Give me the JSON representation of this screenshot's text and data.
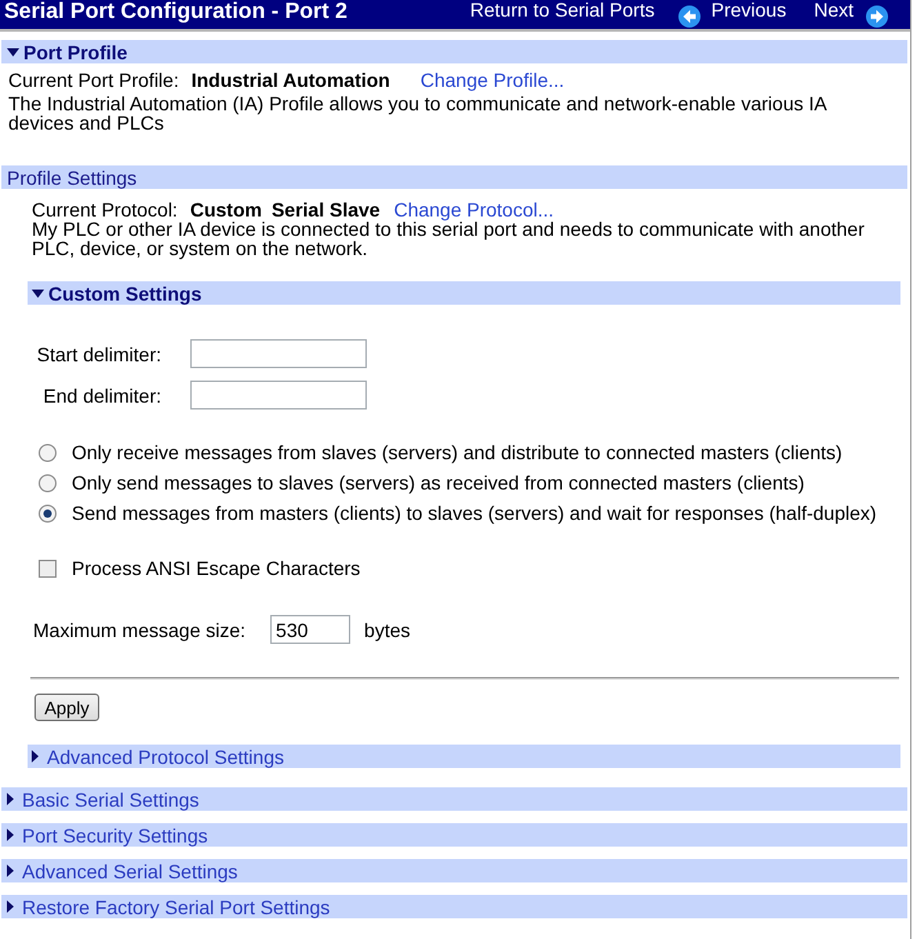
{
  "header": {
    "title": "Serial Port Configuration - Port 2",
    "links": [
      {
        "label": "Return to Serial Ports",
        "kind": "plain"
      },
      {
        "label": "Previous",
        "kind": "back"
      },
      {
        "label": "Next",
        "kind": "forward"
      }
    ]
  },
  "port_profile": {
    "title": "Port Profile",
    "expanded": true,
    "label": "Current Port Profile:",
    "value": "Industrial Automation",
    "link": "Change Profile...",
    "description": "The Industrial Automation (IA) Profile allows you to communicate and network-enable various IA devices and PLCs"
  },
  "profile_settings": {
    "title": "Profile Settings",
    "label": "Current Protocol:",
    "values": [
      "Custom",
      "Serial Slave"
    ],
    "link": "Change Protocol...",
    "description": "My PLC or other IA device is connected to this serial port and needs to communicate with another PLC, device, or system on the network.",
    "custom_settings": {
      "title": "Custom Settings",
      "expanded": true,
      "fields": [
        {
          "label": "Start delimiter:"
        },
        {
          "label": "End delimiter:"
        }
      ],
      "modes": [
        {
          "label": "Only receive messages from slaves (servers) and distribute to connected masters (clients)",
          "selected": false
        },
        {
          "label": "Only send messages to slaves (servers) as received from connected masters (clients)",
          "selected": false
        },
        {
          "label": "Send messages from masters (clients) to slaves (servers) and wait for responses (half-duplex)",
          "selected": true
        }
      ],
      "options": [
        {
          "label": "Process ANSI Escape Characters",
          "checked": false
        }
      ],
      "max_size": {
        "label": "Maximum message size:",
        "value": "530",
        "unit": "bytes"
      },
      "apply": "Apply"
    },
    "advanced_protocol": {
      "title": "Advanced Protocol Settings",
      "expanded": false
    }
  },
  "sections": [
    {
      "title": "Basic Serial Settings",
      "expanded": false
    },
    {
      "title": "Port Security Settings",
      "expanded": false
    },
    {
      "title": "Advanced Serial Settings",
      "expanded": false
    },
    {
      "title": "Restore Factory Serial Port Settings",
      "expanded": false
    }
  ]
}
